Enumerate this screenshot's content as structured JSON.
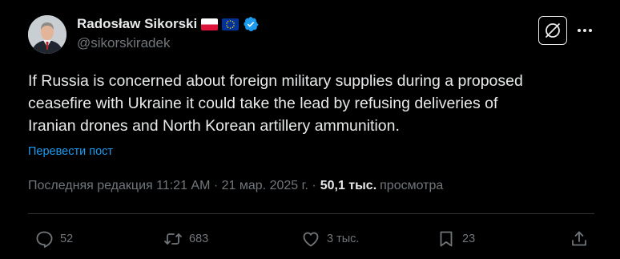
{
  "author": {
    "display_name": "Radosław Sikorski",
    "handle": "@sikorskiradek",
    "flags": [
      "poland-flag",
      "eu-flag"
    ],
    "verified": true
  },
  "tweet": {
    "text_lines": [
      "If Russia is concerned about foreign military supplies during a proposed",
      "ceasefire with Ukraine it could take the lead by refusing deliveries of",
      "Iranian drones and North Korean artillery ammunition."
    ],
    "translate_label": "Перевести пост"
  },
  "meta": {
    "edited_time": "Последняя редакция 11:21 AM · 21 мар. 2025 г. ·",
    "views_count": "50,1 тыс.",
    "views_label": "просмотра"
  },
  "actions": {
    "replies": "52",
    "reposts": "683",
    "likes": "3 тыс.",
    "bookmarks": "23"
  },
  "icons": {
    "grok": "grok-icon",
    "more": "more-icon",
    "reply": "reply-icon",
    "repost": "repost-icon",
    "like": "heart-icon",
    "bookmark": "bookmark-icon",
    "share": "share-icon"
  },
  "colors": {
    "background": "#000000",
    "text": "#e7e9ea",
    "muted": "#71767b",
    "link": "#1d9bf0",
    "verified": "#1d9bf0",
    "divider": "#2f3336"
  }
}
